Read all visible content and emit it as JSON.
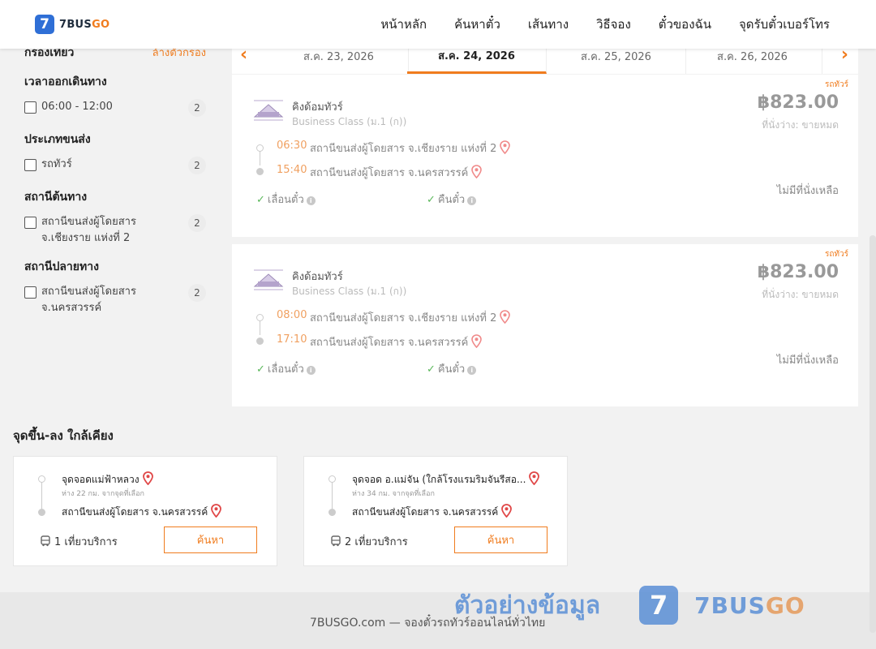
{
  "header": {
    "logo_num": "7",
    "logo_b1": "7BUS",
    "logo_b2": "GO",
    "nav": [
      "หน้าหลัก",
      "ค้นหาตั๋ว",
      "เส้นทาง",
      "วิธีจอง",
      "ตั๋วของฉัน",
      "จุดรับตั๋วเบอร์โทร"
    ]
  },
  "sidebar": {
    "title": "กรองเทียว",
    "clear": "ล้างตัวกรอง",
    "groups": [
      {
        "title": "เวลาออกเดินทาง",
        "option": "06:00 - 12:00",
        "count": "2"
      },
      {
        "title": "ประเภทขนส่ง",
        "option": "รถทัวร์",
        "count": "2"
      },
      {
        "title": "สถานีต้นทาง",
        "option": "สถานีขนส่งผู้โดยสาร จ.เชียงราย แห่งที่ 2",
        "count": "2"
      },
      {
        "title": "สถานีปลายทาง",
        "option": "สถานีขนส่งผู้โดยสาร จ.นครสวรรค์",
        "count": "2"
      }
    ]
  },
  "dates": {
    "tabs": [
      "ส.ค. 23, 2026",
      "ส.ค. 24, 2026",
      "ส.ค. 25, 2026",
      "ส.ค. 26, 2026"
    ],
    "active_index": 1
  },
  "trips": [
    {
      "tag": "รถทัวร์",
      "operator": "คิงด้อมทัวร์",
      "class": "Business Class (ม.1 (ก))",
      "price": "฿823.00",
      "seats": "ที่นั่งว่าง: ขายหมด",
      "depart_time": "06:30",
      "depart_station": "สถานีขนส่งผู้โดยสาร จ.เชียงราย แห่งที่ 2",
      "arrive_time": "15:40",
      "arrive_station": "สถานีขนส่งผู้โดยสาร จ.นครสวรรค์",
      "perk1": "เลื่อนตั๋ว",
      "perk2": "คืนตั๋ว",
      "no_seat": "ไม่มีที่นั่งเหลือ"
    },
    {
      "tag": "รถทัวร์",
      "operator": "คิงด้อมทัวร์",
      "class": "Business Class (ม.1 (ก))",
      "price": "฿823.00",
      "seats": "ที่นั่งว่าง: ขายหมด",
      "depart_time": "08:00",
      "depart_station": "สถานีขนส่งผู้โดยสาร จ.เชียงราย แห่งที่ 2",
      "arrive_time": "17:10",
      "arrive_station": "สถานีขนส่งผู้โดยสาร จ.นครสวรรค์",
      "perk1": "เลื่อนตั๋ว",
      "perk2": "คืนตั๋ว",
      "no_seat": "ไม่มีที่นั่งเหลือ"
    }
  ],
  "nearby": {
    "title": "จุดขึ้น-ลง ใกล้เคียง",
    "cards": [
      {
        "from": "จุดจอดแม่ฟ้าหลวง",
        "distance": "ห่าง 22 กม. จากจุดที่เลือก",
        "to": "สถานีขนส่งผู้โดยสาร จ.นครสวรรค์",
        "trips": "1 เที่ยวบริการ",
        "button": "ค้นหา"
      },
      {
        "from": "จุดจอด อ.แม่จัน (ใกล้โรงแรมริมจันรีสอ...",
        "distance": "ห่าง 34 กม. จากจุดที่เลือก",
        "to": "สถานีขนส่งผู้โดยสาร จ.นครสวรรค์",
        "trips": "2 เที่ยวบริการ",
        "button": "ค้นหา"
      }
    ]
  },
  "footer": {
    "text": "7BUSGO.com — จองตั๋วรถทัวร์ออนไลน์ทั่วไทย"
  },
  "watermark": {
    "text": "ตัวอย่างข้อมูล",
    "logo_num": "7",
    "brand1": "7BUS",
    "brand2": "GO"
  },
  "colors": {
    "accent": "#f07c1e",
    "brand_blue": "#2f6fd6",
    "check_green": "#5ab85a",
    "pin_red": "#e04848"
  },
  "icons": [
    "chevron-left-icon",
    "chevron-right-icon",
    "map-pin-icon",
    "check-icon",
    "info-icon",
    "bus-icon",
    "bus-operator-logo"
  ]
}
